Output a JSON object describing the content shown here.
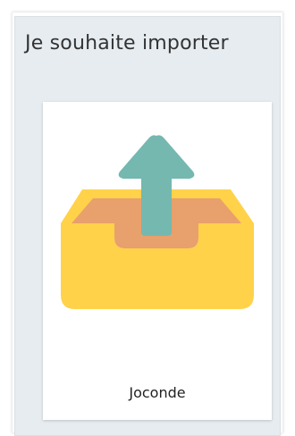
{
  "dialog": {
    "title": "Je souhaite importer"
  },
  "options": [
    {
      "label": "Joconde",
      "icon": "inbox-upload-icon"
    }
  ],
  "colors": {
    "panel_bg": "#e6ecf0",
    "tray_yellow": "#ffd24a",
    "tray_inner": "#e8a06c",
    "arrow_teal": "#74b8b0"
  }
}
